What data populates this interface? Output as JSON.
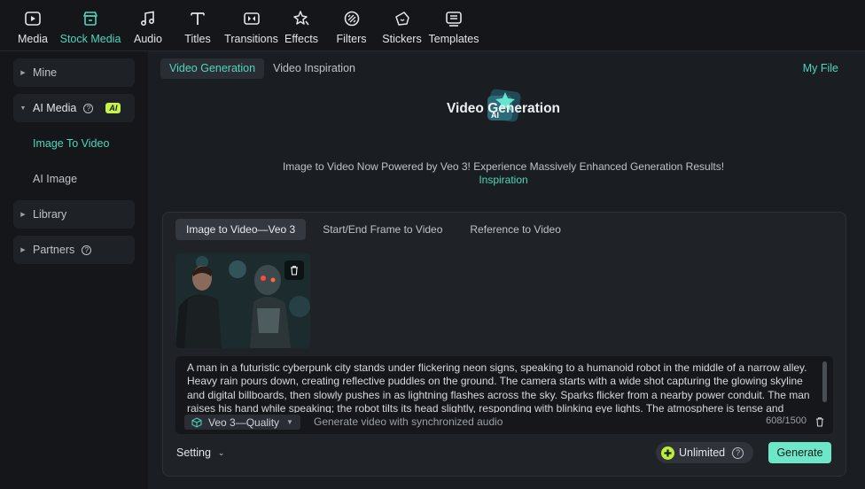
{
  "toolbar": {
    "items": [
      {
        "label": "Media",
        "icon": "media-icon"
      },
      {
        "label": "Stock Media",
        "icon": "stock-media-icon",
        "active": true
      },
      {
        "label": "Audio",
        "icon": "music-note-icon"
      },
      {
        "label": "Titles",
        "icon": "text-icon"
      },
      {
        "label": "Transitions",
        "icon": "transition-icon"
      },
      {
        "label": "Effects",
        "icon": "effects-icon"
      },
      {
        "label": "Filters",
        "icon": "filter-icon"
      },
      {
        "label": "Stickers",
        "icon": "sticker-icon"
      },
      {
        "label": "Templates",
        "icon": "template-icon"
      }
    ]
  },
  "sidebar": {
    "mine": "Mine",
    "ai_media": "AI Media",
    "ai_badge": "AI",
    "image_to_video": "Image To Video",
    "ai_image": "AI Image",
    "library": "Library",
    "partners": "Partners"
  },
  "main": {
    "tabs": [
      "Video Generation",
      "Video Inspiration"
    ],
    "my_file": "My File",
    "hero_badge": "AI",
    "title": "Video Generation",
    "description": "Image to Video Now Powered by Veo 3! Experience Massively Enhanced Generation Results!",
    "inspiration_link": "Inspiration"
  },
  "card": {
    "tabs": [
      "Image to Video—Veo 3",
      "Start/End Frame to Video",
      "Reference to Video"
    ],
    "prompt": "A man in a futuristic cyberpunk city stands under flickering neon signs, speaking to a humanoid robot in the middle of a narrow alley. Heavy rain pours down, creating reflective puddles on the ground. The camera starts with a wide shot capturing the glowing skyline and digital billboards, then slowly pushes in as lightning flashes across the sky. Sparks flicker from a nearby power conduit. The man raises his hand while speaking; the robot tilts its head slightly, responding with blinking eye lights. The atmosphere is tense and",
    "model": "Veo 3—Quality",
    "audio_note": "Generate video with synchronized audio",
    "char_count": "608/1500",
    "setting": "Setting",
    "unlimited": "Unlimited",
    "generate": "Generate"
  },
  "colors": {
    "accent": "#4fd6bd",
    "generate_button": "#6ee7c8",
    "ai_badge": "#c6f24a"
  }
}
